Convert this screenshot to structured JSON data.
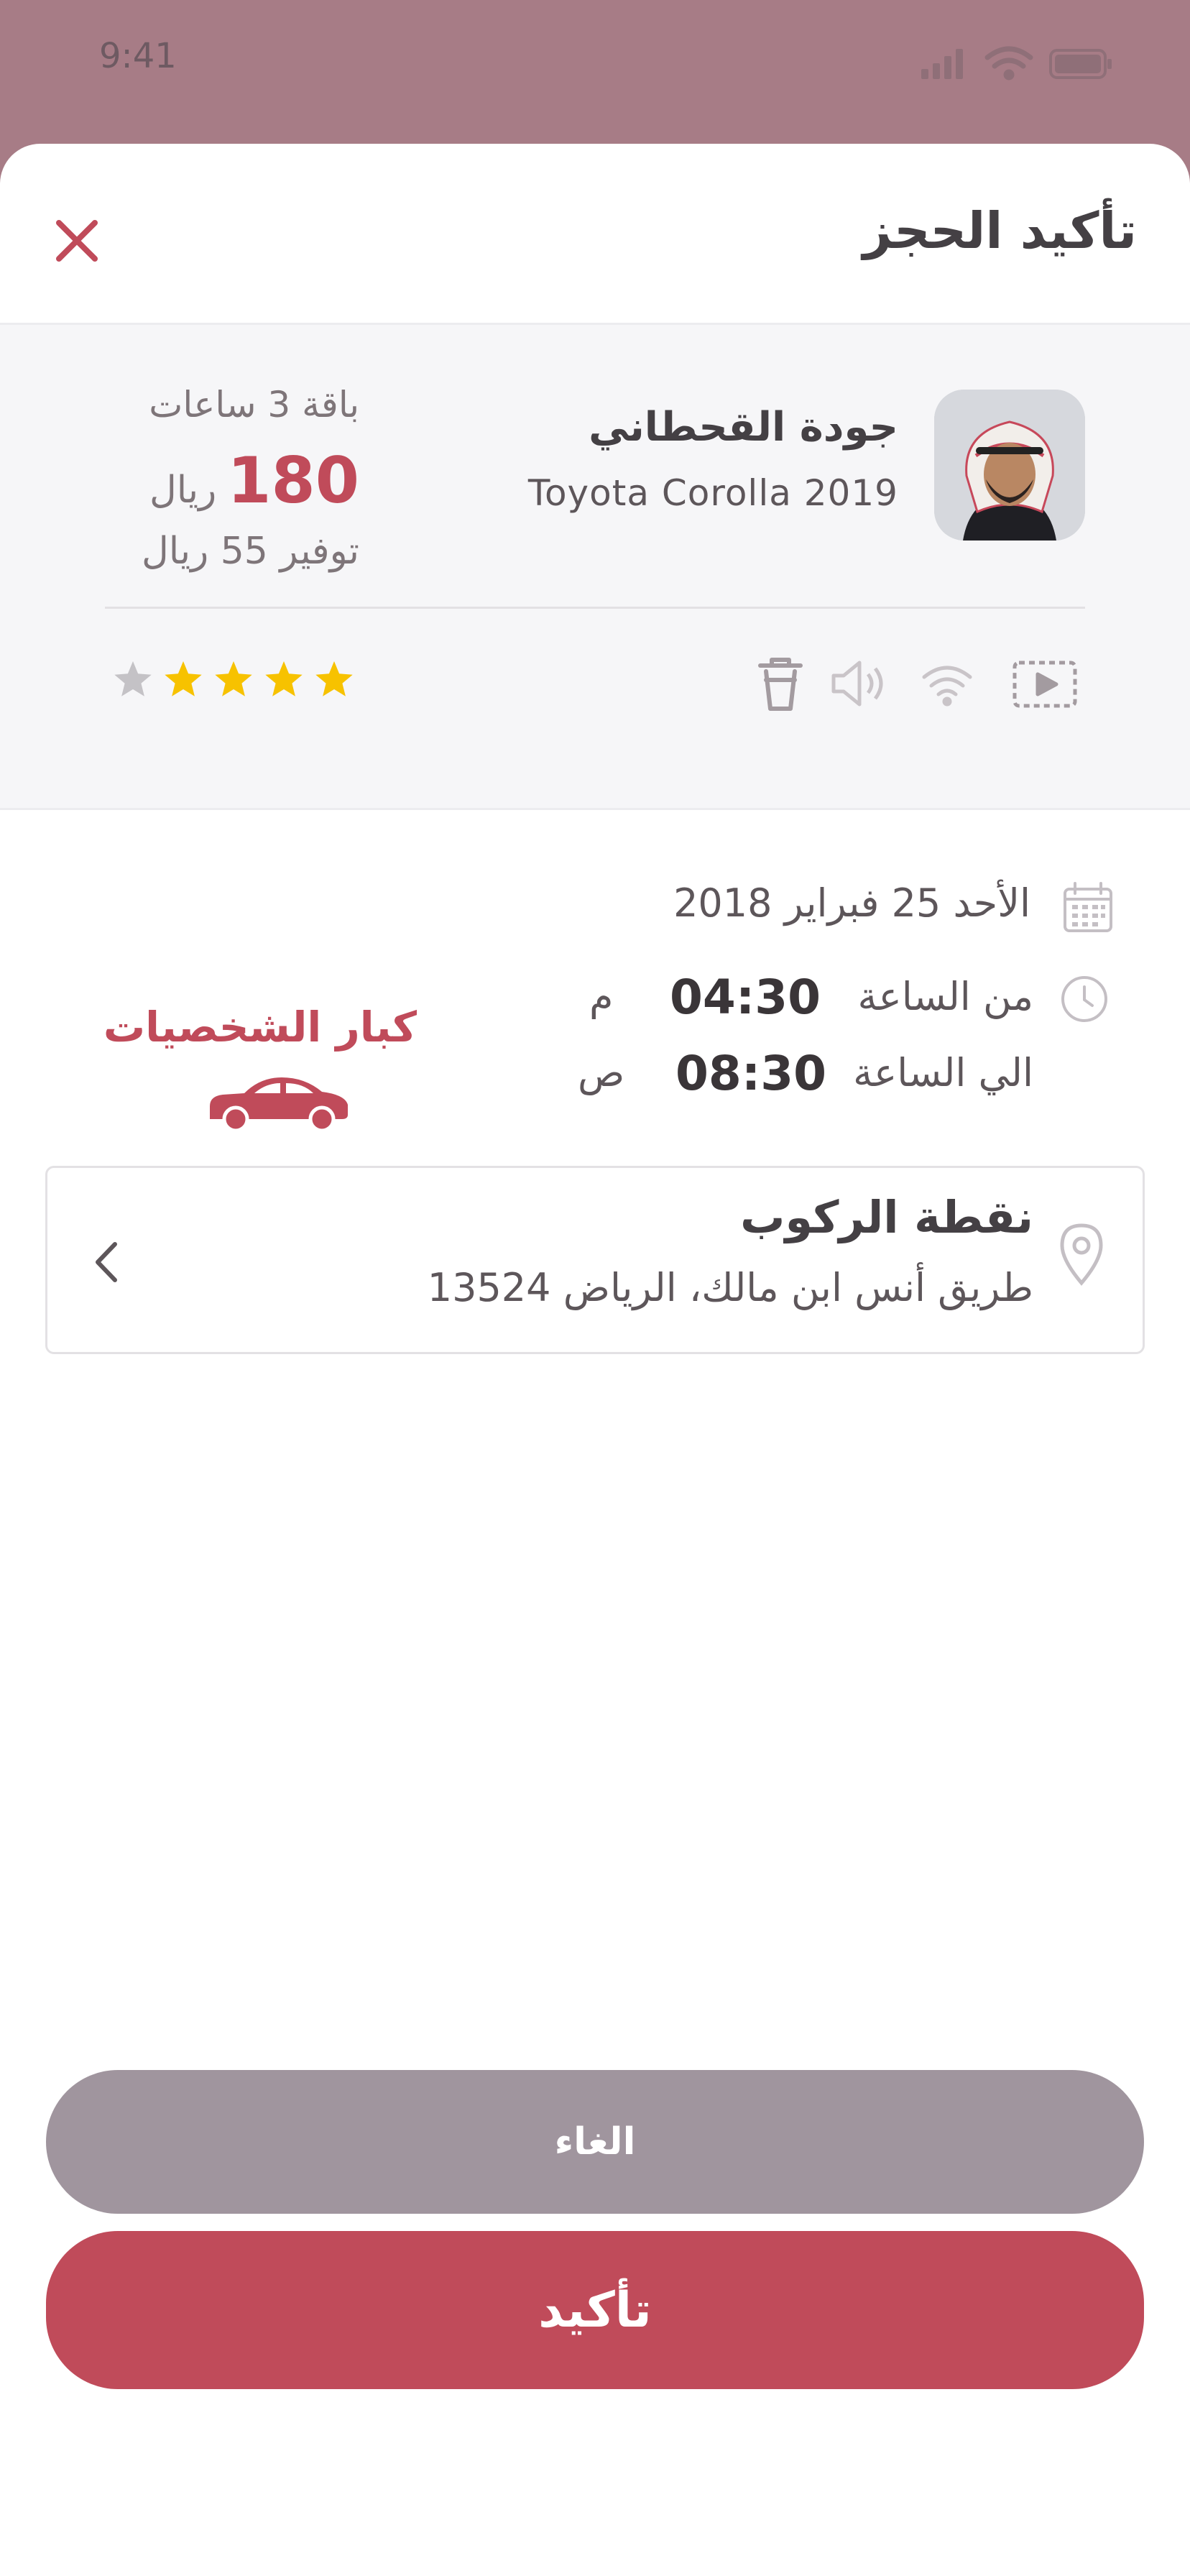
{
  "status_bar": {
    "time": "9:41"
  },
  "header": {
    "title": "تأكيد الحجز"
  },
  "driver": {
    "name": "جودة القحطاني",
    "car": "Toyota Corolla 2019",
    "rating": 4,
    "rating_max": 5
  },
  "package": {
    "label": "باقة 3 ساعات",
    "price": "180",
    "currency": "ريال",
    "saving": "توفير 55 ريال"
  },
  "amenities": [
    "video-icon",
    "wifi-icon",
    "speaker-icon",
    "trash-icon"
  ],
  "booking": {
    "date": "الأحد 25 فبراير 2018",
    "from_label": "من الساعة",
    "from_time": "04:30",
    "from_ampm": "م",
    "to_label": "الي الساعة",
    "to_time": "08:30",
    "to_ampm": "ص",
    "category": "كبار الشخصيات"
  },
  "pickup": {
    "title": "نقطة الركوب",
    "address": "طريق أنس ابن مالك، الرياض 13524"
  },
  "actions": {
    "cancel": "الغاء",
    "confirm": "تأكيد"
  },
  "colors": {
    "accent": "#c04b5a",
    "overlay": "#a77c86",
    "cancel": "#a0959e",
    "star": "#f7c200",
    "star_off": "#c4c2c6"
  }
}
